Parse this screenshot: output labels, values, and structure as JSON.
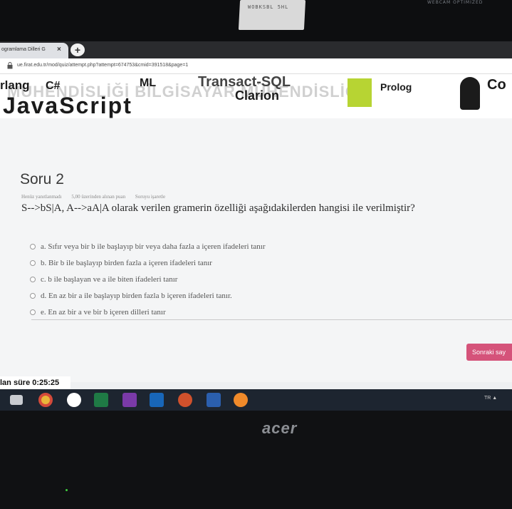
{
  "bezel": {
    "webcam_label": "WOBKSBL 5HL",
    "corner_logo": "WEBCAM OPTIMIZED"
  },
  "browser": {
    "tab_title": "ogramlama Dilleri G",
    "tab_close": "×",
    "new_tab": "+",
    "url": "ue.firat.edu.tr/mod/quiz/attempt.php?attempt=674753&cmid=391518&page=1"
  },
  "banner": {
    "words": [
      "rlang",
      "C#",
      "ML",
      "Transact-SQL",
      "Clarion",
      "Prolog",
      "Co",
      "JavaScript"
    ],
    "watermark": "MÜHENDİSLİĞİ BİLGİSAYAR MÜHENDİSLİĞİ"
  },
  "quiz": {
    "question_number": "Soru 2",
    "meta": {
      "status": "Henüz yanıtlanmadı",
      "points": "5,00 üzerinden alınan puan",
      "flag": "Soruyu işaretle"
    },
    "question_text": "S-->bS|A, A-->aA|A olarak verilen gramerin özelliği aşağıdakilerden hangisi ile verilmiştir?",
    "options": [
      "a. Sıfır veya bir b ile başlayıp bir veya daha fazla a içeren ifadeleri tanır",
      "b. Bir b ile başlayıp birden fazla a içeren ifadeleri tanır",
      "c. b ile başlayan ve a ile biten ifadeleri tanır",
      "d. En az bir a ile başlayıp birden fazla b içeren ifadeleri tanır.",
      "e. En az bir a ve bir b içeren dilleri tanır"
    ],
    "next_button": "Sonraki say",
    "timer": "lan süre 0:25:25"
  },
  "taskbar": {
    "tray": "TR ▲"
  },
  "laptop": {
    "brand": "acer"
  }
}
